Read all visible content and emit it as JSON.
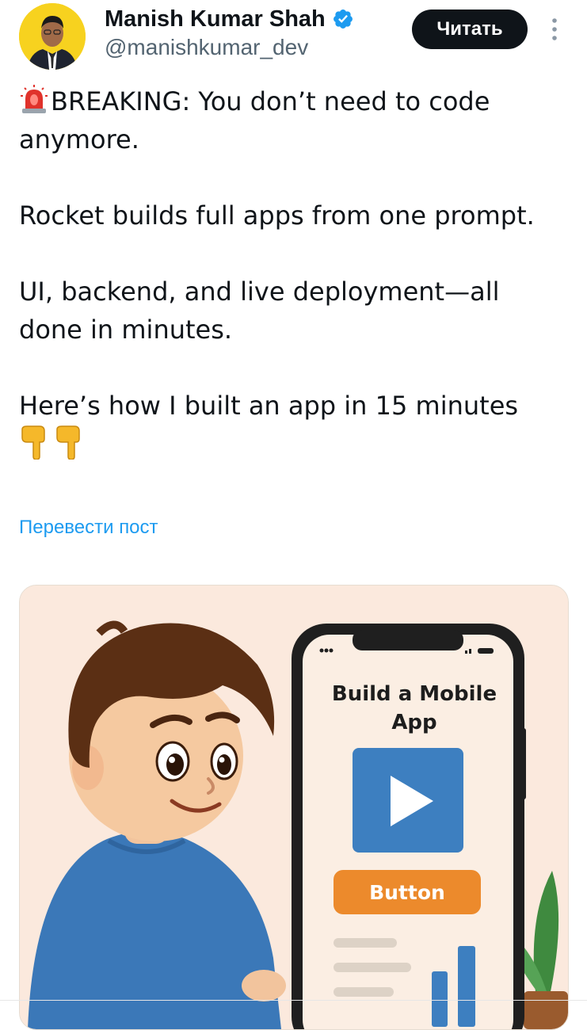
{
  "author": {
    "name": "Manish Kumar Shah",
    "handle": "@manishkumar_dev",
    "verified_icon": "verified-badge-icon",
    "avatar_background": "#f7d21f"
  },
  "actions": {
    "follow_label": "Читать",
    "more_icon": "more-vertical-icon"
  },
  "tweet": {
    "paragraphs": [
      "BREAKING: You don’t need to code anymore.",
      "Rocket builds full apps from one prompt.",
      "UI, backend, and live deployment—all done in minutes.",
      "Here’s how I built an app in 15 minutes"
    ],
    "leading_emoji": "rotating-light-icon",
    "trailing_emoji": [
      "pointing-down-icon",
      "pointing-down-icon"
    ],
    "translate_label": "Перевести пост"
  },
  "media": {
    "phone_title": "Build a Mobile App",
    "phone_button": "Button",
    "background": "#fbe9dd"
  },
  "colors": {
    "link": "#1d9bf0",
    "text": "#0f1419",
    "secondary": "#536471",
    "accent_orange": "#ec8a2c",
    "accent_blue": "#3d7fc0"
  }
}
